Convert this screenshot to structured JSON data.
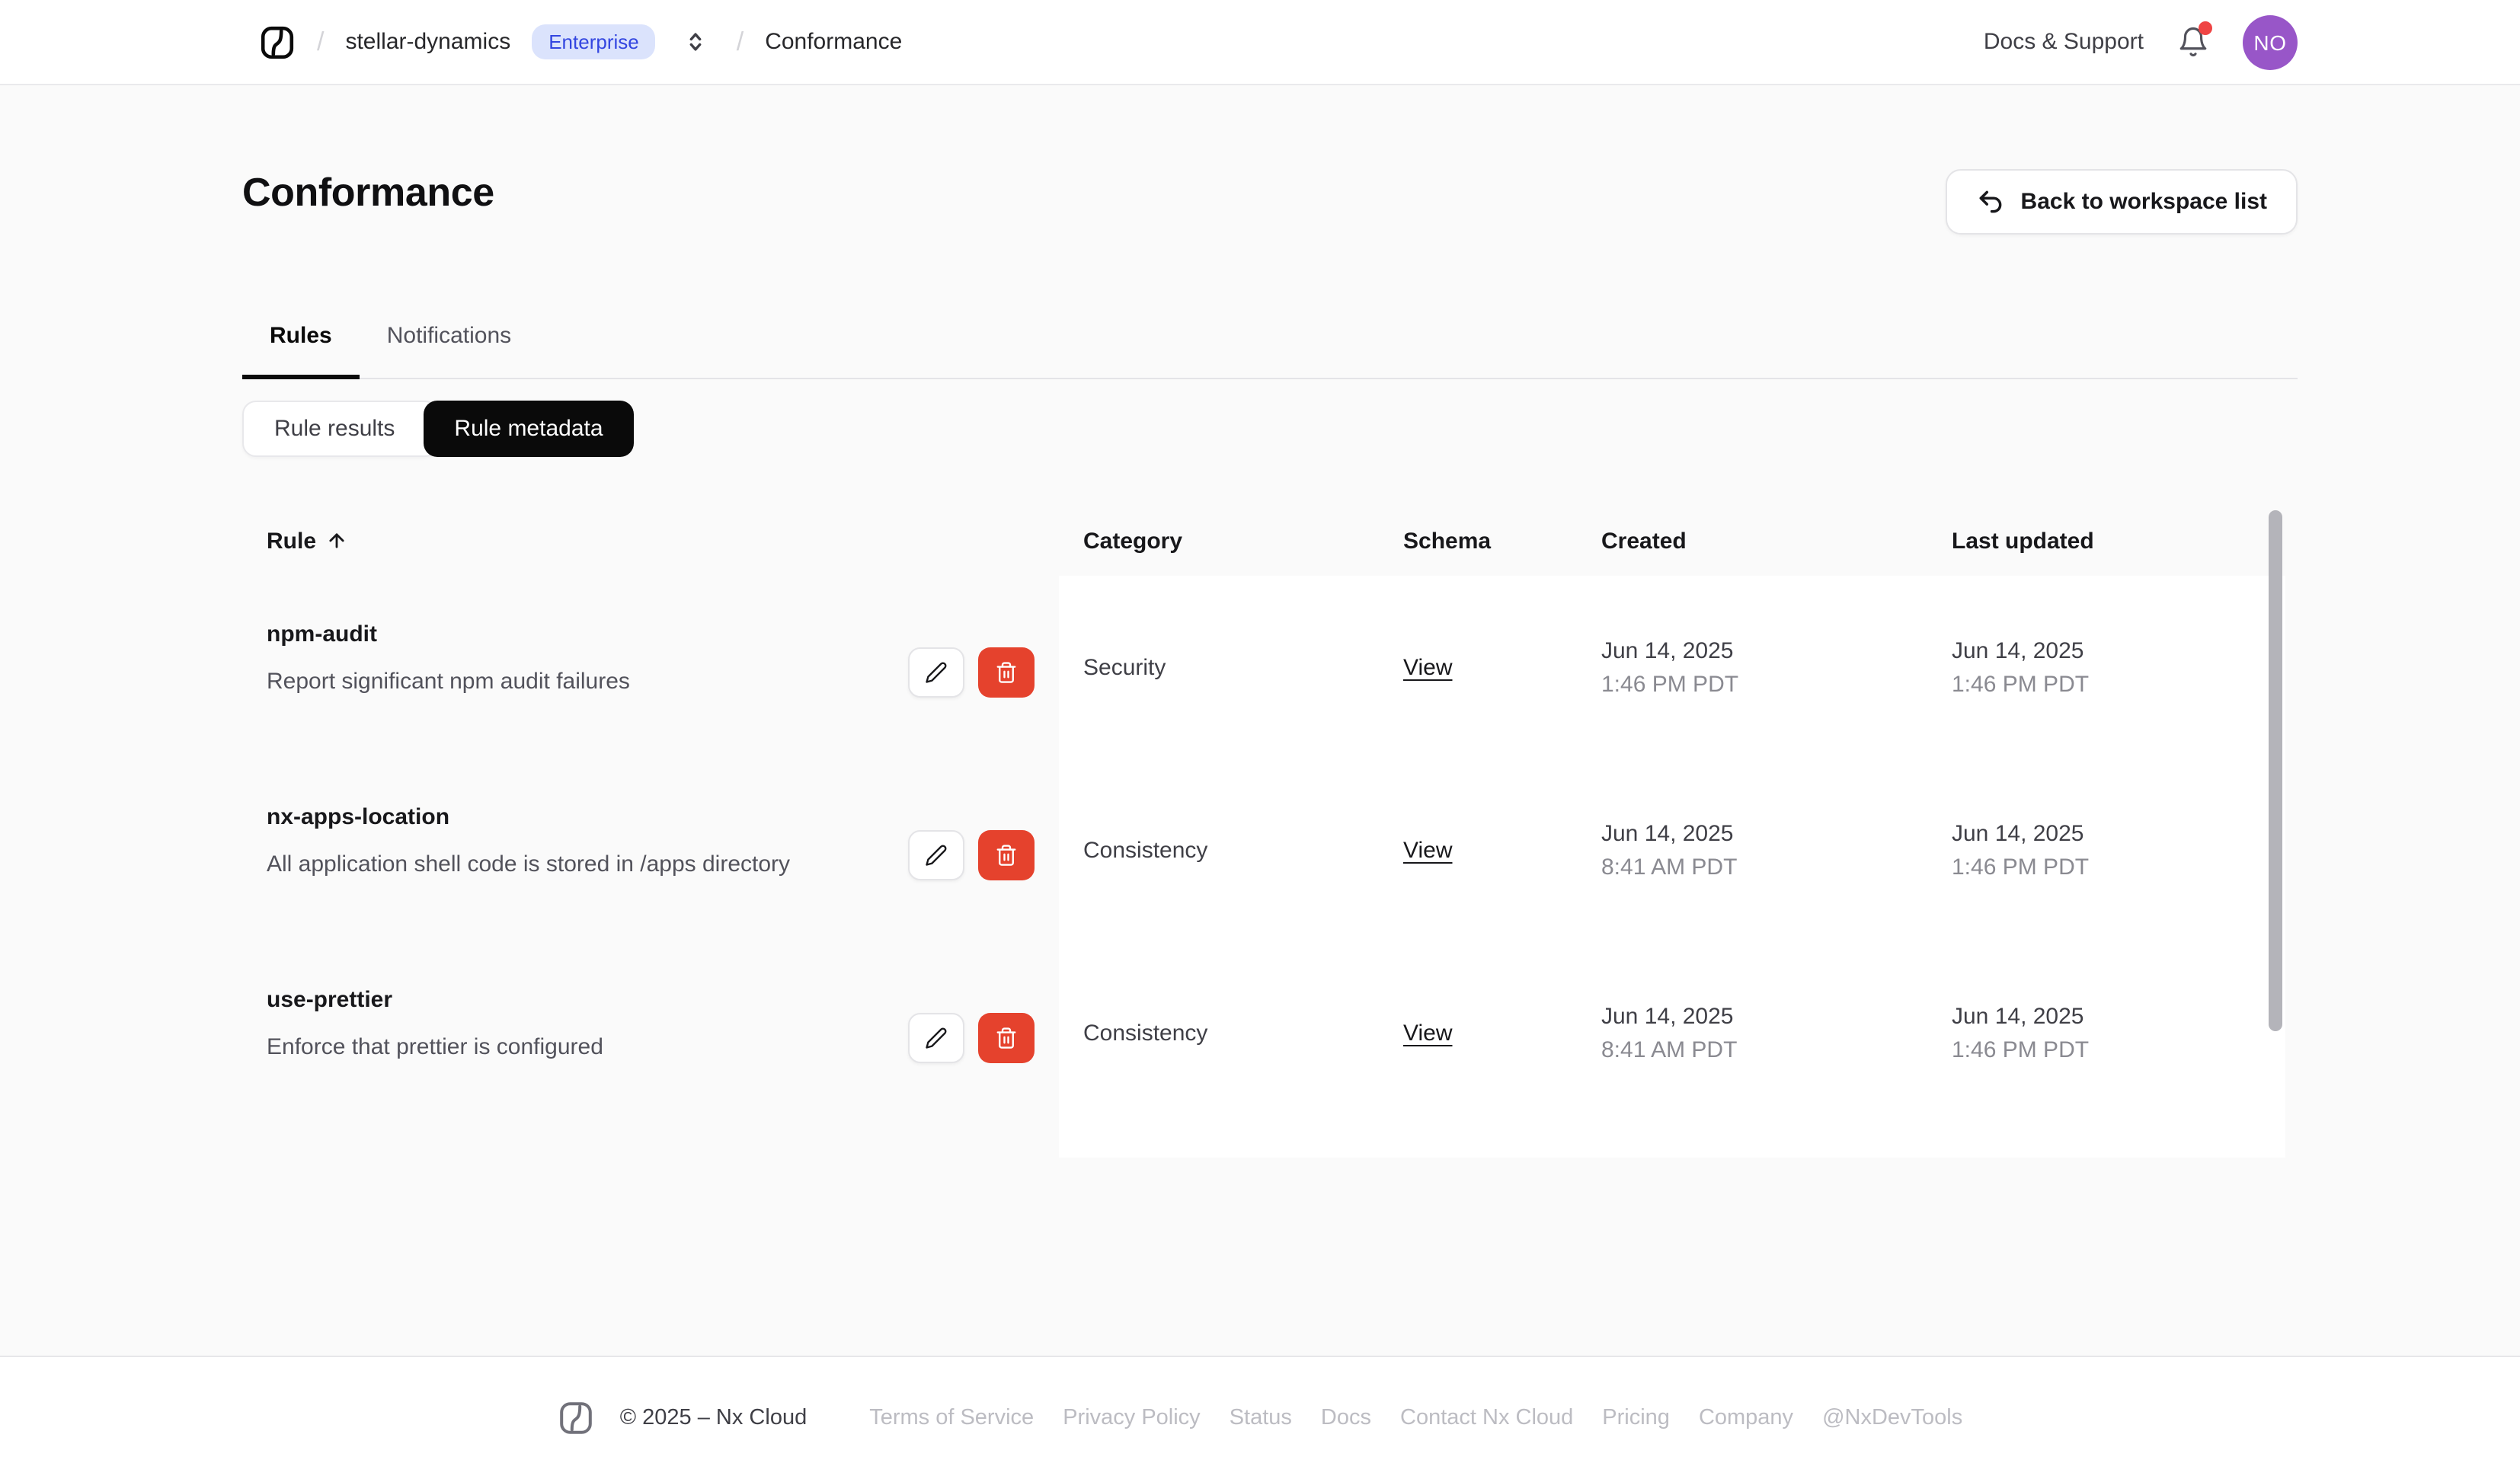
{
  "navbar": {
    "workspace": "stellar-dynamics",
    "plan_badge": "Enterprise",
    "breadcrumb_page": "Conformance",
    "docs_support_label": "Docs & Support",
    "avatar_initials": "NO",
    "has_unread_notifications": true
  },
  "page": {
    "title": "Conformance",
    "back_button_label": "Back to workspace list"
  },
  "tabs": [
    {
      "label": "Rules",
      "active": true
    },
    {
      "label": "Notifications",
      "active": false
    }
  ],
  "view_toggle": [
    {
      "label": "Rule results",
      "active": false
    },
    {
      "label": "Rule metadata",
      "active": true
    }
  ],
  "table": {
    "columns": [
      "Rule",
      "Category",
      "Schema",
      "Created",
      "Last updated"
    ],
    "sort_column": "Rule",
    "sort_direction": "ascending",
    "rows": [
      {
        "rule": "npm-audit",
        "description": "Report significant npm audit failures",
        "category": "Security",
        "schema_link": "View",
        "created_date": "Jun 14, 2025",
        "created_time": "1:46 PM PDT",
        "updated_date": "Jun 14, 2025",
        "updated_time": "1:46 PM PDT"
      },
      {
        "rule": "nx-apps-location",
        "description": "All application shell code is stored in /apps directory",
        "category": "Consistency",
        "schema_link": "View",
        "created_date": "Jun 14, 2025",
        "created_time": "8:41 AM PDT",
        "updated_date": "Jun 14, 2025",
        "updated_time": "1:46 PM PDT"
      },
      {
        "rule": "use-prettier",
        "description": "Enforce that prettier is configured",
        "category": "Consistency",
        "schema_link": "View",
        "created_date": "Jun 14, 2025",
        "created_time": "8:41 AM PDT",
        "updated_date": "Jun 14, 2025",
        "updated_time": "1:46 PM PDT"
      }
    ]
  },
  "footer": {
    "copyright": "© 2025 – Nx Cloud",
    "links": [
      "Terms of Service",
      "Privacy Policy",
      "Status",
      "Docs",
      "Contact Nx Cloud",
      "Pricing",
      "Company",
      "@NxDevTools"
    ]
  },
  "colors": {
    "page_background": "#fafafa",
    "surface": "#ffffff",
    "badge_background": "#dbe3fc",
    "badge_text": "#3346e0",
    "delete_red": "#e5422d",
    "avatar_purple": "#9856c8",
    "notification_dot": "#ef4444",
    "active_segment": "#0a0a0a"
  }
}
